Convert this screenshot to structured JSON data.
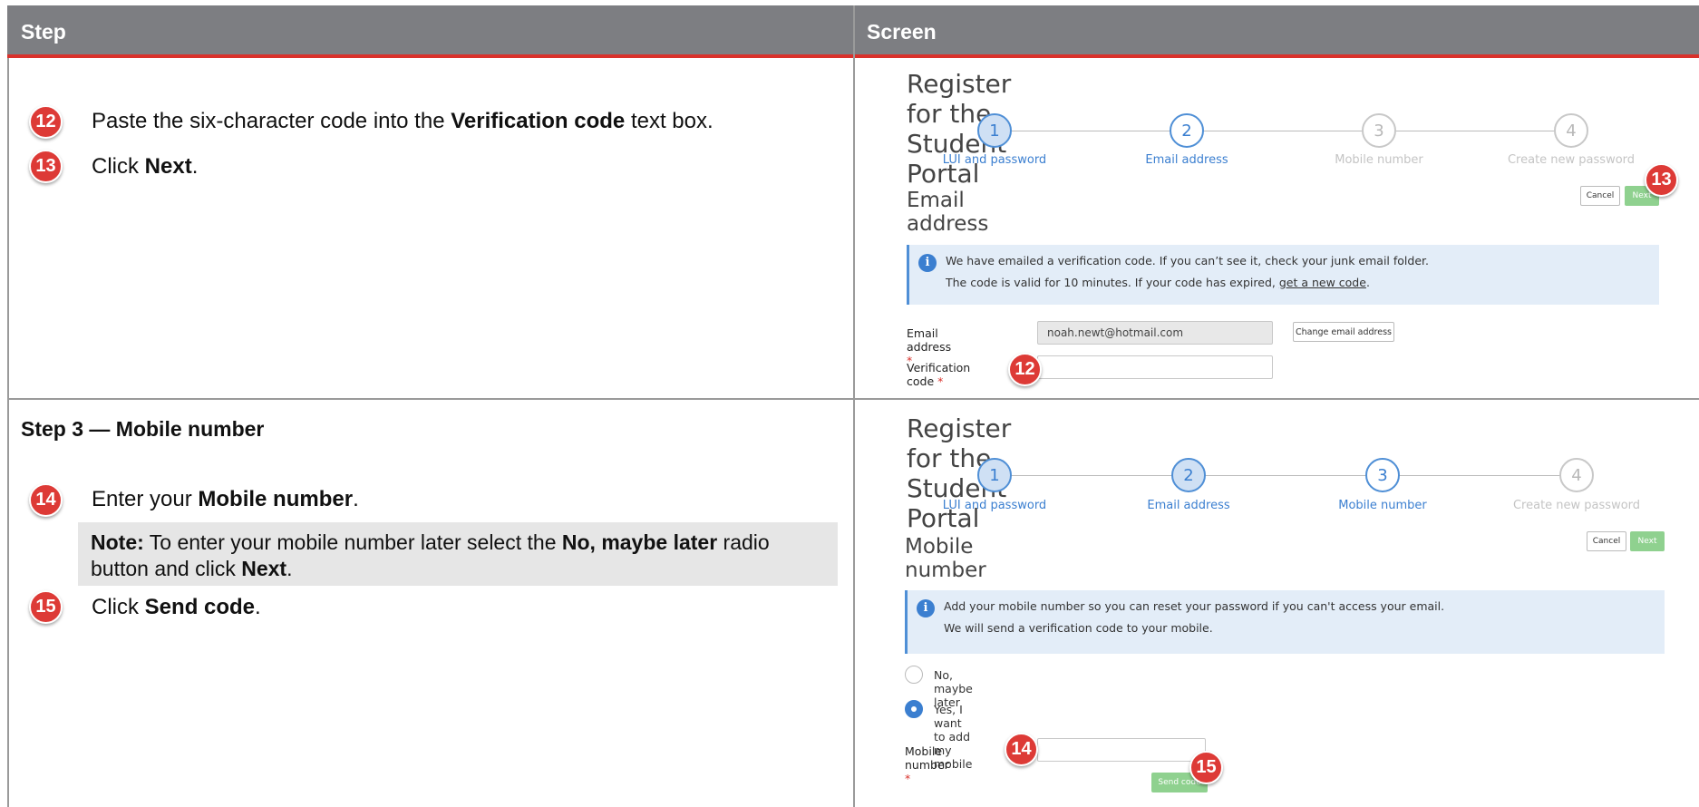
{
  "header": {
    "step": "Step",
    "screen": "Screen"
  },
  "row1": {
    "steps": [
      {
        "num": "12",
        "pre": "Paste the six-character code into the ",
        "bold": "Verification code",
        "post": " text box."
      },
      {
        "num": "13",
        "pre": "Click ",
        "bold": "Next",
        "post": "."
      }
    ],
    "screen": {
      "title": "Register for the Student Portal",
      "stepper": [
        "1",
        "2",
        "3",
        "4"
      ],
      "stepper_labels": [
        "LUI and password",
        "Email address",
        "Mobile number",
        "Create new password"
      ],
      "section": "Email address",
      "cancel": "Cancel",
      "next": "Next",
      "next_badge": "13",
      "info_line1": "We have emailed a verification code. If you can’t see it, check your junk email folder.",
      "info_line2_pre": "The code is valid for 10 minutes. If your code has expired, ",
      "info_line2_link": "get a new code",
      "info_line2_post": ".",
      "email_label": "Email address",
      "email_value": "noah.newt@hotmail.com",
      "change_email": "Change email address",
      "verif_label": "Verification code",
      "verif_badge": "12",
      "req": "*"
    }
  },
  "row2": {
    "heading": "Step 3 — Mobile number",
    "step14": {
      "num": "14",
      "pre": "Enter your ",
      "bold": "Mobile number",
      "post": "."
    },
    "note": {
      "label": "Note:",
      "pre": " To enter your mobile number later select the ",
      "bold": "No, maybe later",
      "mid": " radio button and click ",
      "bold2": "Next",
      "post": "."
    },
    "step15": {
      "num": "15",
      "pre": "Click ",
      "bold": "Send code",
      "post": "."
    },
    "screen": {
      "title": "Register for the Student Portal",
      "stepper": [
        "1",
        "2",
        "3",
        "4"
      ],
      "stepper_labels": [
        "LUI and password",
        "Email address",
        "Mobile number",
        "Create new password"
      ],
      "section": "Mobile number",
      "cancel": "Cancel",
      "next": "Next",
      "info_line1": "Add your mobile number so you can reset your password if you can't access your email.",
      "info_line2": "We will send a verification code to your mobile.",
      "radio_no": "No, maybe later",
      "radio_yes": "Yes, I want to add my mobile",
      "mobile_label": "Mobile number",
      "mobile_badge": "14",
      "send_code": "Send code",
      "send_badge": "15",
      "req": "*"
    }
  }
}
